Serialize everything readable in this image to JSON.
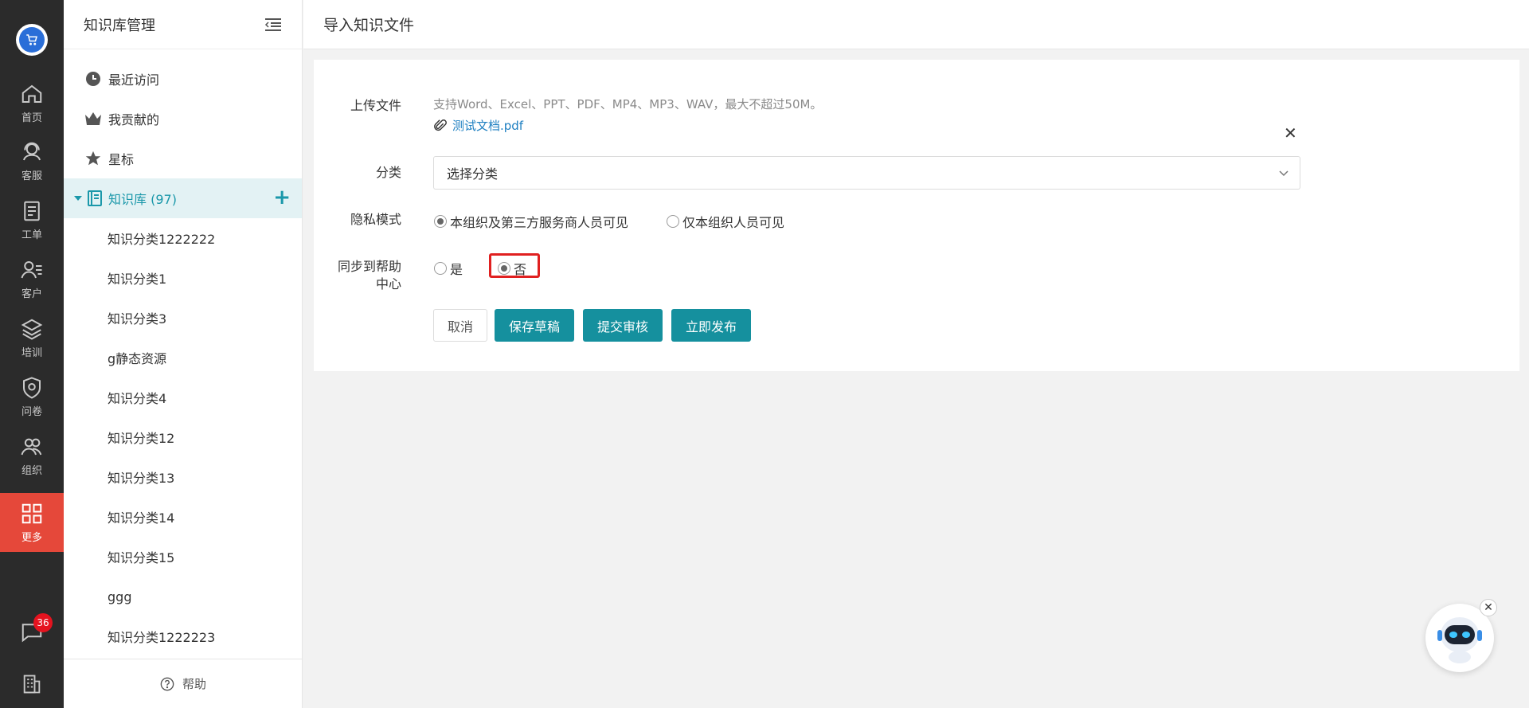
{
  "rail": {
    "items": [
      {
        "label": "首页",
        "icon": "home-icon"
      },
      {
        "label": "客服",
        "icon": "headset-icon"
      },
      {
        "label": "工单",
        "icon": "ticket-icon"
      },
      {
        "label": "客户",
        "icon": "customer-icon"
      },
      {
        "label": "培训",
        "icon": "layers-icon"
      },
      {
        "label": "问卷",
        "icon": "survey-icon"
      },
      {
        "label": "组织",
        "icon": "organization-icon"
      },
      {
        "label": "更多",
        "icon": "grid-icon"
      }
    ],
    "badge_count": "36",
    "active_color": "#e5483a"
  },
  "sidebar": {
    "title": "知识库管理",
    "items": [
      {
        "label": "最近访问",
        "icon": "clock-icon"
      },
      {
        "label": "我贡献的",
        "icon": "crown-icon"
      },
      {
        "label": "星标",
        "icon": "star-icon"
      }
    ],
    "knowledge_base": {
      "label": "知识库 (97)"
    },
    "categories": [
      "知识分类1222222",
      "知识分类1",
      "知识分类3",
      "g静态资源",
      "知识分类4",
      "知识分类12",
      "知识分类13",
      "知识分类14",
      "知识分类15",
      "ggg",
      "知识分类1222223"
    ],
    "footer_help": "帮助"
  },
  "page": {
    "title": "导入知识文件"
  },
  "form": {
    "upload_label": "上传文件",
    "upload_hint": "支持Word、Excel、PPT、PDF、MP4、MP3、WAV，最大不超过50M。",
    "file_name": "测试文档.pdf",
    "category_label": "分类",
    "category_value": "选择分类",
    "privacy_label": "隐私模式",
    "privacy_options": [
      "本组织及第三方服务商人员可见",
      "仅本组织人员可见"
    ],
    "privacy_selected": 0,
    "sync_label_line1": "同步到帮助",
    "sync_label_line2": "中心",
    "sync_options": [
      "是",
      "否"
    ],
    "sync_selected": 1
  },
  "buttons": {
    "cancel": "取消",
    "save_draft": "保存草稿",
    "submit_review": "提交审核",
    "publish": "立即发布"
  },
  "colors": {
    "primary": "#15909e",
    "link": "#1e7fc1",
    "highlight": "#e02020"
  }
}
